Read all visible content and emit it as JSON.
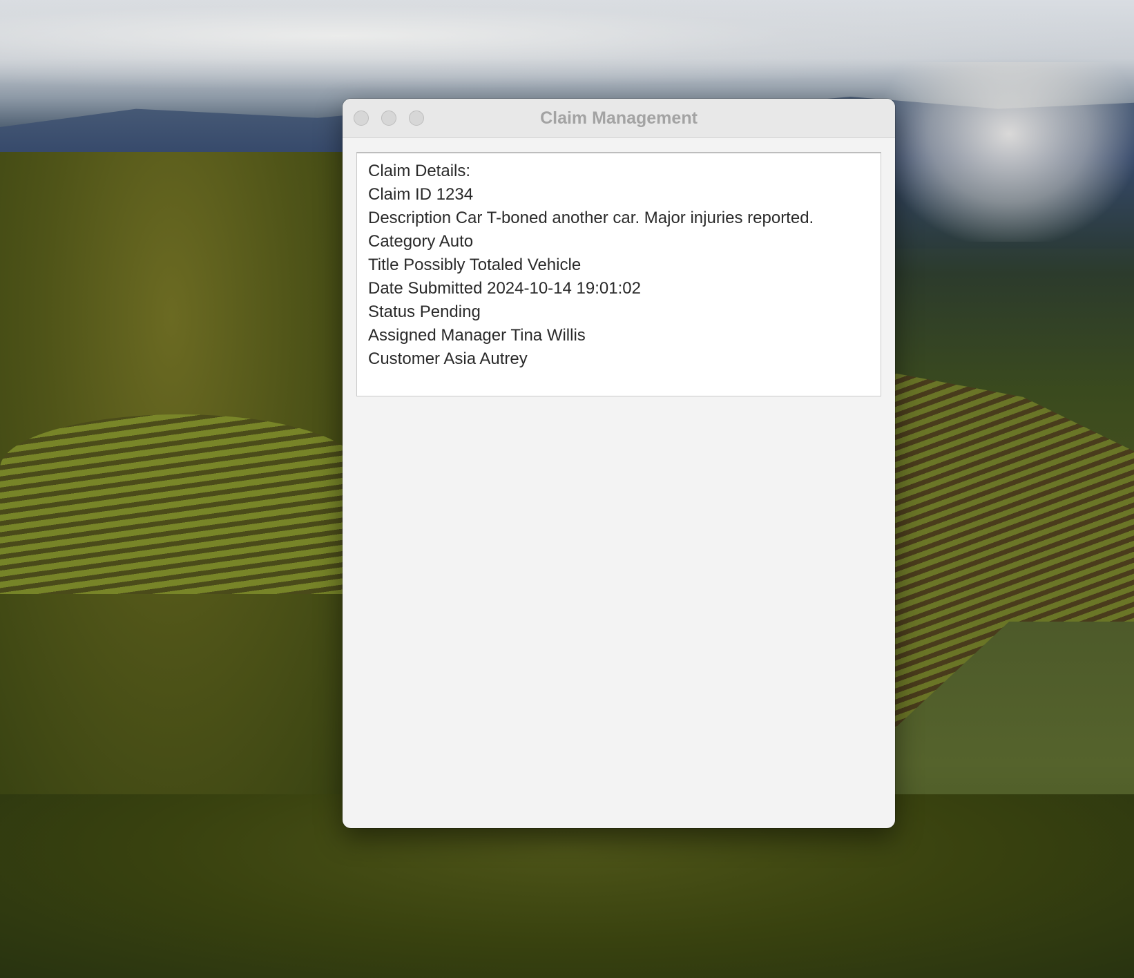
{
  "window": {
    "title": "Claim Management"
  },
  "claim_details": {
    "heading": "Claim Details:",
    "claim_id": "Claim ID 1234",
    "description": "Description Car T-boned another car. Major injuries reported.",
    "category": "Category Auto",
    "title": "Title Possibly Totaled Vehicle",
    "date_submitted": "Date Submitted 2024-10-14 19:01:02",
    "status": "Status Pending",
    "assigned_manager": "Assigned Manager Tina Willis",
    "customer": "Customer Asia Autrey"
  },
  "colors": {
    "window_background": "#f3f3f3",
    "titlebar_background": "#e8e8e8",
    "title_text": "#a3a3a3",
    "body_text": "#2a2a2a",
    "traffic_light_inactive": "#d7d7d7"
  },
  "icons": {
    "close": "close-icon",
    "minimize": "minimize-icon",
    "zoom": "zoom-icon"
  }
}
